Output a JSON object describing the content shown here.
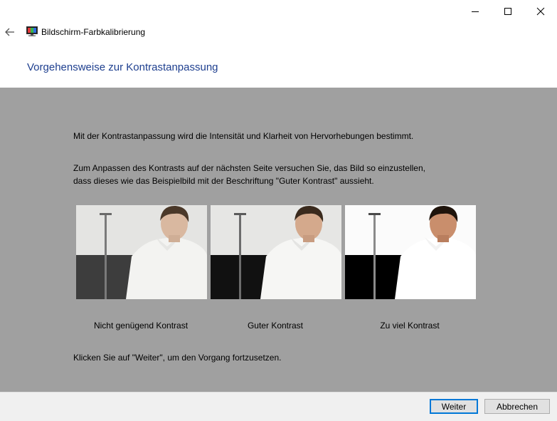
{
  "window": {
    "title": "Bildschirm-Farbkalibrierung"
  },
  "page": {
    "heading": "Vorgehensweise zur Kontrastanpassung",
    "intro": "Mit der Kontrastanpassung wird die Intensität und Klarheit von Hervorhebungen bestimmt.",
    "instruction_line1": "Zum Anpassen des Kontrasts auf der nächsten Seite versuchen Sie, das Bild so einzustellen,",
    "instruction_line2": "dass dieses wie das Beispielbild mit der Beschriftung \"Guter Kontrast\" aussieht.",
    "examples": [
      {
        "caption": "Nicht genügend Kontrast"
      },
      {
        "caption": "Guter Kontrast"
      },
      {
        "caption": "Zu viel Kontrast"
      }
    ],
    "continue_hint": "Klicken Sie auf \"Weiter\", um den Vorgang fortzusetzen."
  },
  "footer": {
    "next_label": "Weiter",
    "cancel_label": "Abbrechen"
  },
  "colors": {
    "heading": "#1e3f8f",
    "content_bg": "#a0a0a0",
    "default_button_border": "#0078d7"
  }
}
